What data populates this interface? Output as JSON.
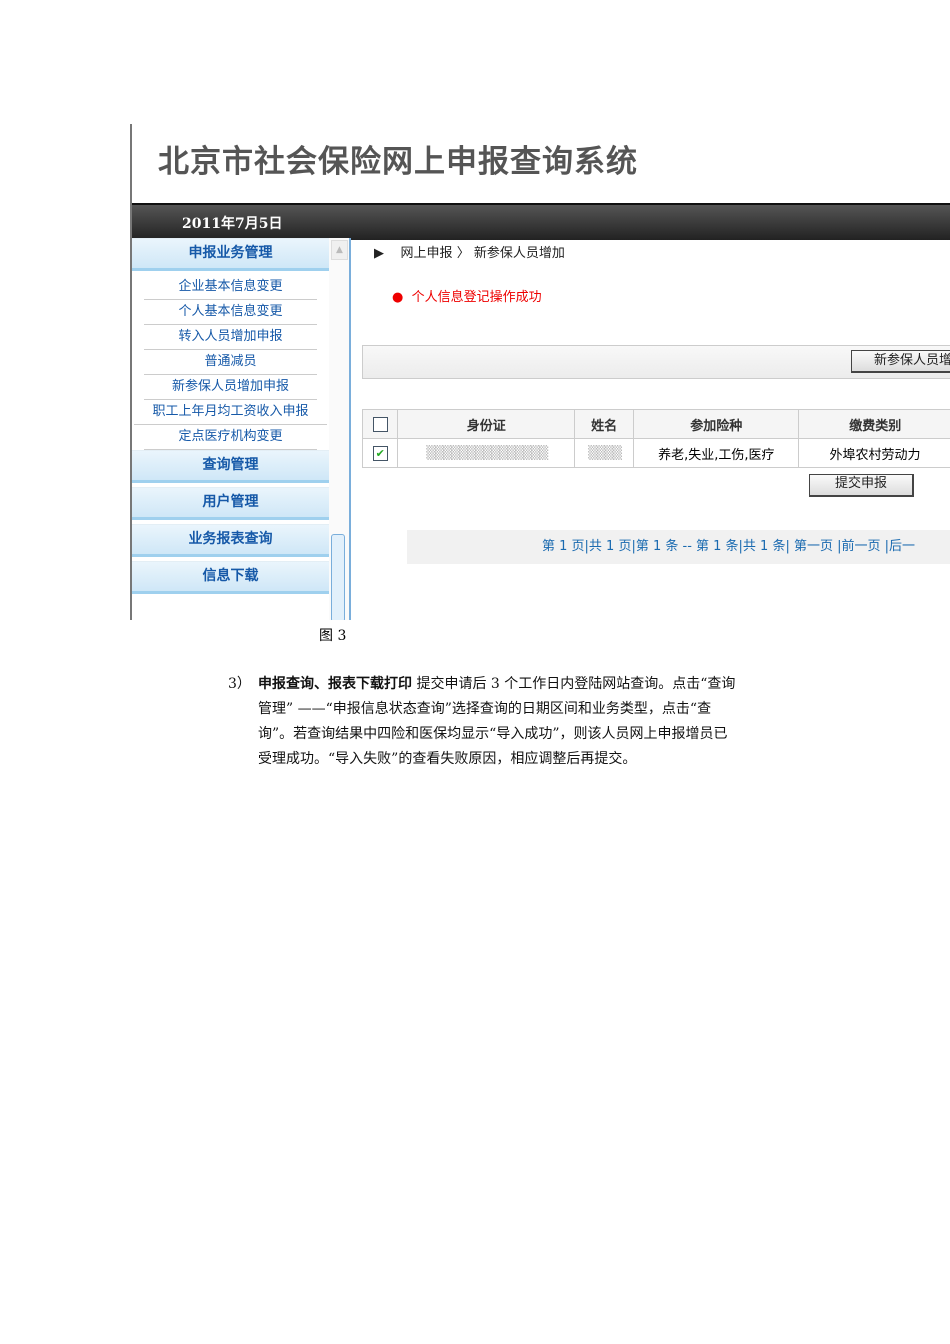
{
  "screenshot": {
    "system_title": "北京市社会保险网上申报查询系统",
    "date": "2011年7月5日",
    "sidebar": {
      "groups": [
        {
          "label": "申报业务管理",
          "items": [
            "企业基本信息变更",
            "个人基本信息变更",
            "转入人员增加申报",
            "普通减员",
            "新参保人员增加申报",
            "职工上年月均工资收入申报",
            "定点医疗机构变更"
          ]
        },
        {
          "label": "查询管理"
        },
        {
          "label": "用户管理"
        },
        {
          "label": "业务报表查询"
        },
        {
          "label": "信息下载"
        }
      ]
    },
    "breadcrumb": {
      "arrow": "▶",
      "part1": "网上申报",
      "sep": "〉",
      "part2": "新参保人员增加"
    },
    "message": "个人信息登记操作成功",
    "toolbar_button": "新参保人员增",
    "table": {
      "headers": [
        "身份证",
        "姓名",
        "参加险种",
        "缴费类别"
      ],
      "rows": [
        {
          "checked": true,
          "insurance": "养老,失业,工伤,医疗",
          "category": "外埠农村劳动力"
        }
      ]
    },
    "submit_button": "提交申报",
    "pager": "第 1 页|共 1 页|第 1 条 -- 第 1 条|共 1 条| 第一页 |前一页 |后一"
  },
  "caption": "图 3",
  "paragraph": {
    "number": "3）",
    "heading": "申报查询、报表下载打印",
    "line1": " 提交申请后 3 个工作日内登陆网站查询。点击“查询",
    "line2": "管理”  ——“申报信息状态查询”选择查询的日期区间和业务类型，点击“查",
    "line3": "询”。若查询结果中四险和医保均显示“导入成功”，则该人员网上申报增员已",
    "line4": "受理成功。“导入失败”的查看失败原因，相应调整后再提交。"
  }
}
